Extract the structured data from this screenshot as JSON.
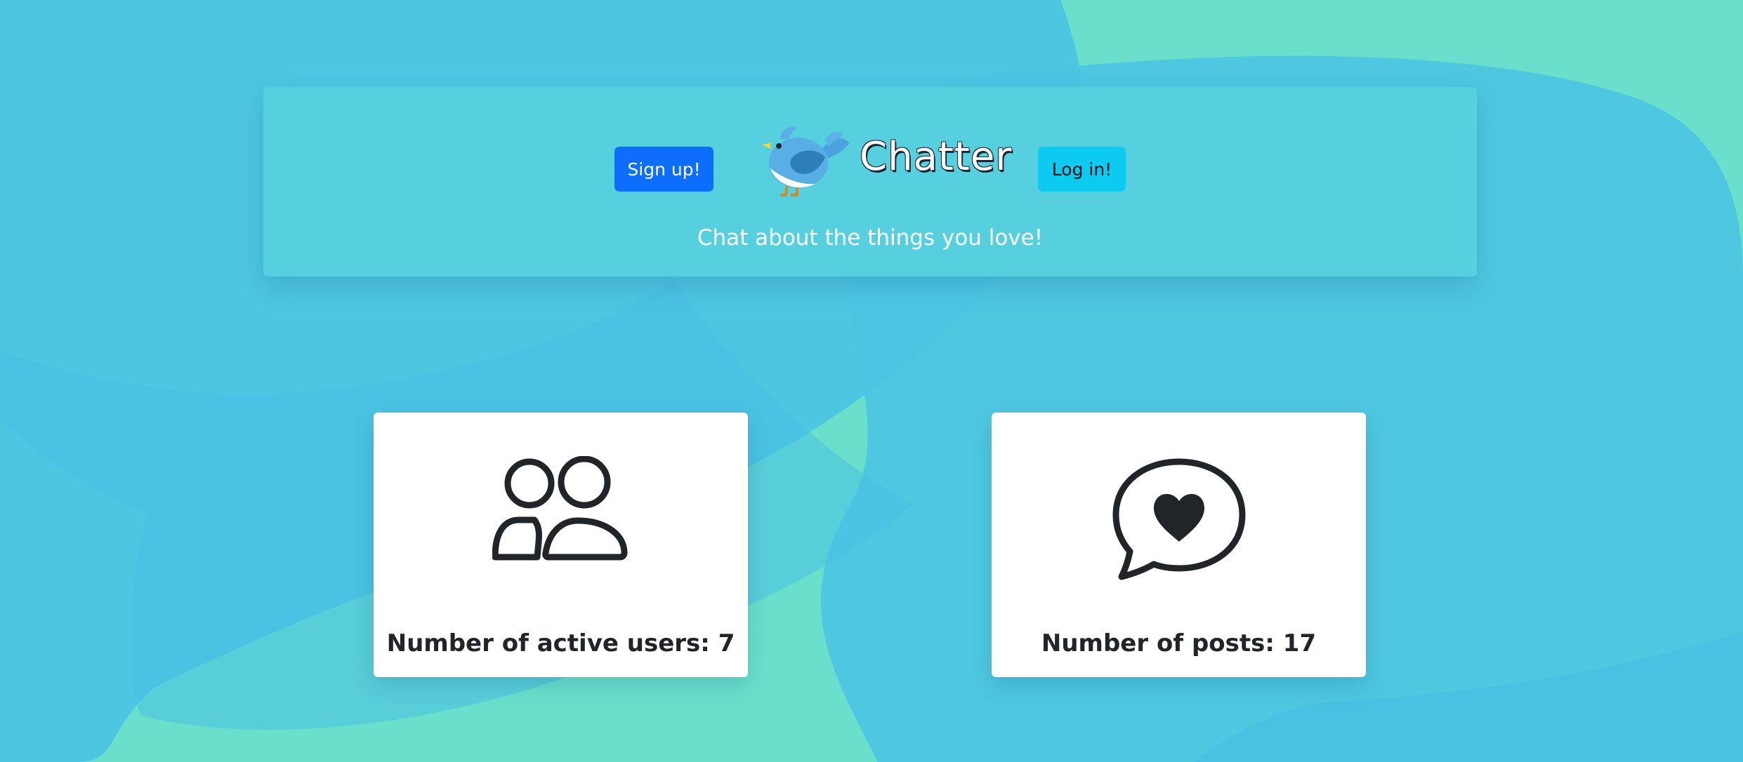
{
  "colors": {
    "background": "#6ae0cc",
    "blob": "#4cc4e3",
    "signup_button": "#0d6efd",
    "login_button": "#0dcaf0",
    "icon": "#212529"
  },
  "header": {
    "signup_label": "Sign up!",
    "login_label": "Log in!",
    "brand": "Chatter",
    "logo_icon": "bird-logo-icon",
    "tagline": "Chat about the things you love!"
  },
  "stats": {
    "users": {
      "icon": "people-icon",
      "text": "Number of active users: 7"
    },
    "posts": {
      "icon": "chat-heart-icon",
      "text": "Number of posts: 17"
    }
  }
}
